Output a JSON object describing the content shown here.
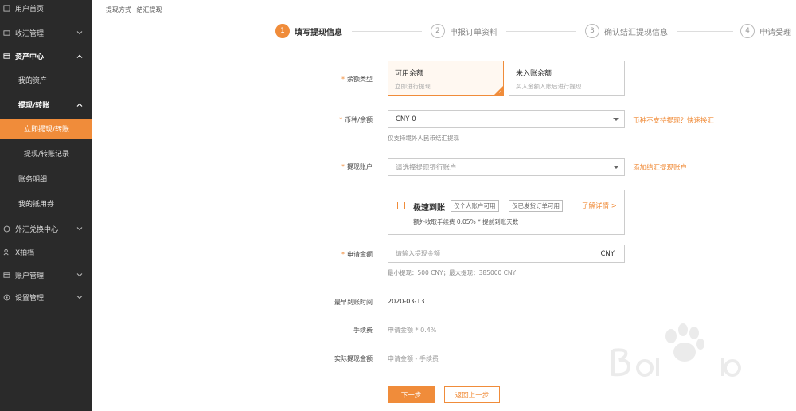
{
  "sidebar": {
    "home": "用户首页",
    "fx_collection": "收汇管理",
    "asset_center": "资产中心",
    "my_assets": "我的资产",
    "withdraw_transfer": "提现/转账",
    "withdraw_now": "立即提现/转账",
    "withdraw_records": "提现/转账记录",
    "account_details": "账务明细",
    "my_vouchers": "我的抵用券",
    "fx_exchange": "外汇兑换中心",
    "x_archive": "X拍档",
    "account_mgmt": "账户管理",
    "settings_mgmt": "设置管理"
  },
  "breadcrumb": {
    "part1": "提现方式",
    "part2": "结汇提现"
  },
  "steps": [
    {
      "num": "1",
      "label": "填写提现信息"
    },
    {
      "num": "2",
      "label": "申报订单资料"
    },
    {
      "num": "3",
      "label": "确认结汇提现信息"
    },
    {
      "num": "4",
      "label": "申请受理"
    }
  ],
  "form": {
    "balance_type": {
      "label": "余额类型",
      "options": [
        {
          "title": "可用余额",
          "desc": "立即进行提现"
        },
        {
          "title": "未入账余额",
          "desc": "买入金额入账后进行提现"
        }
      ]
    },
    "currency": {
      "label": "币种/余额",
      "value": "CNY 0",
      "hint": "仅支持境外人民币结汇提现",
      "link": "币种不支持提现？快速换汇"
    },
    "account": {
      "label": "提现账户",
      "placeholder": "请选择提现银行账户",
      "link": "添加结汇提现账户"
    },
    "fast": {
      "title": "极速到账",
      "tag1": "仅个人账户可用",
      "tag2": "仅已发货订单可用",
      "more": "了解详情 >",
      "desc": "额外收取手续费 0.05% * 提前到账天数"
    },
    "amount": {
      "label": "申请金额",
      "placeholder": "请输入提现金额",
      "unit": "CNY",
      "hint": "最小提现：500 CNY；最大提现：385000 CNY"
    },
    "earliest": {
      "label": "最早到账时间",
      "value": "2020-03-13"
    },
    "fee": {
      "label": "手续费",
      "value": "申请金额 * 0.4%"
    },
    "actual": {
      "label": "实际提现金额",
      "value": "申请金额 - 手续费"
    }
  },
  "buttons": {
    "next": "下一步",
    "back": "返回上一步"
  },
  "colors": {
    "accent": "#f08c3a",
    "sidebar_bg": "#2a2a2a"
  }
}
